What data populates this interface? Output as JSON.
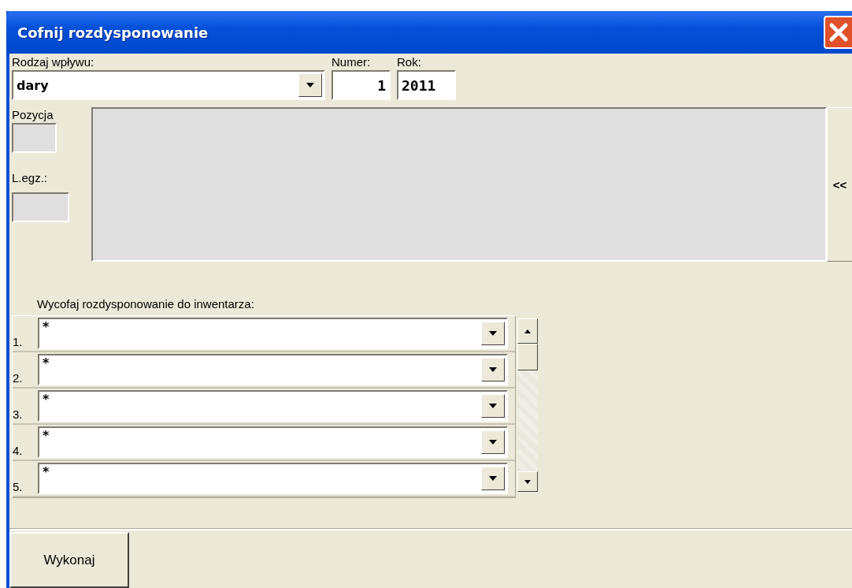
{
  "window": {
    "title": "Cofnij rozdysponowanie"
  },
  "header": {
    "type_label": "Rodzaj wpływu:",
    "type_value": "dary",
    "number_label": "Numer:",
    "number_value": "1",
    "year_label": "Rok:",
    "year_value": "2011"
  },
  "position": {
    "position_label": "Pozycja",
    "copy_label": "L.egz.:",
    "collapse_button": "<<"
  },
  "inventory": {
    "label": "Wycofaj rozdysponowanie do inwentarza:",
    "rows": [
      {
        "number": "1.",
        "value": "*"
      },
      {
        "number": "2.",
        "value": "*"
      },
      {
        "number": "3.",
        "value": "*"
      },
      {
        "number": "4.",
        "value": "*"
      },
      {
        "number": "5.",
        "value": "*"
      }
    ]
  },
  "buttons": [
    "Wykonaj"
  ]
}
